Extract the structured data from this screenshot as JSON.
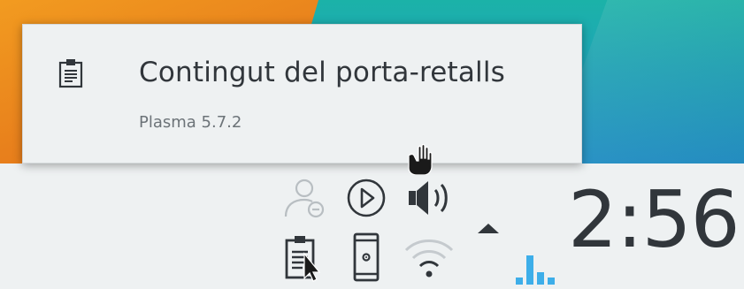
{
  "tooltip": {
    "title": "Contingut del porta-retalls",
    "subtitle": "Plasma 5.7.2",
    "icon": "clipboard-icon"
  },
  "systray": {
    "icons_row1": [
      "user-away-icon",
      "media-play-icon",
      "volume-icon"
    ],
    "icons_row2": [
      "clipboard-icon",
      "phone-settings-icon",
      "wifi-icon"
    ],
    "expand_icon": "arrow-up-icon",
    "clock": "2:56"
  },
  "colors": {
    "panel_bg": "#eef1f2",
    "text": "#31363b",
    "muted": "#6c7378",
    "accent_blue": "#3daee9",
    "wallpaper_orange": "#e8801c",
    "wallpaper_teal": "#1fa6b8"
  }
}
